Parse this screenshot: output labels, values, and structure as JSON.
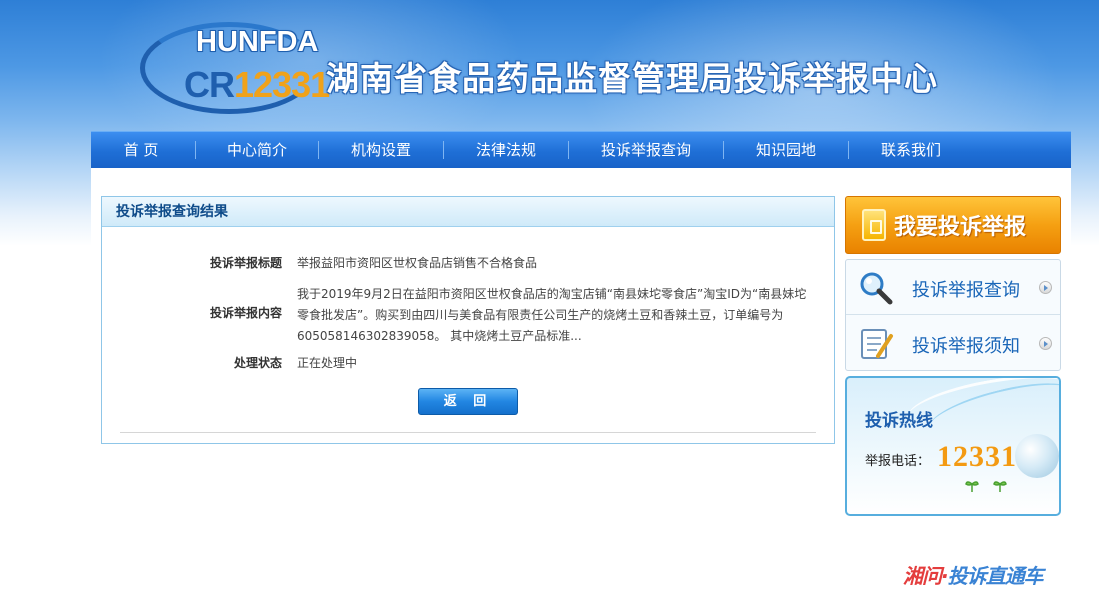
{
  "header": {
    "logo_line1": "HUNFDA",
    "logo_line2_prefix": "CR",
    "logo_line2_number": "12331",
    "site_title": "湖南省食品药品监督管理局投诉举报中心"
  },
  "nav": {
    "items": [
      {
        "label": "首 页"
      },
      {
        "label": "中心简介"
      },
      {
        "label": "机构设置"
      },
      {
        "label": "法律法规"
      },
      {
        "label": "投诉举报查询"
      },
      {
        "label": "知识园地"
      },
      {
        "label": "联系我们"
      }
    ]
  },
  "result": {
    "panel_title": "投诉举报查询结果",
    "title_label": "投诉举报标题",
    "title_value": "举报益阳市资阳区世权食品店销售不合格食品",
    "content_label": "投诉举报内容",
    "content_value": "我于2019年9月2日在益阳市资阳区世权食品店的淘宝店铺“南县妹坨零食店”淘宝ID为“南县妹坨零食批发店”。购买到由四川与美食品有限责任公司生产的烧烤土豆和香辣土豆，订单编号为605058146302839058。 其中烧烤土豆产品标准...",
    "status_label": "处理状态",
    "status_value": "正在处理中",
    "back_button": "返 回"
  },
  "sidebar": {
    "complain_button": "我要投诉举报",
    "query_link": "投诉举报查询",
    "notice_link": "投诉举报须知",
    "hotline_title": "投诉热线",
    "hotline_label": "举报电话：",
    "hotline_number": "12331"
  },
  "footer": {
    "watermark_red": "湘问·",
    "watermark_blue": "投诉直通车"
  },
  "colors": {
    "nav_blue": "#1f6fd6",
    "panel_border": "#8fc6e8",
    "accent_orange": "#f5a012",
    "link_blue": "#1a66b8"
  }
}
